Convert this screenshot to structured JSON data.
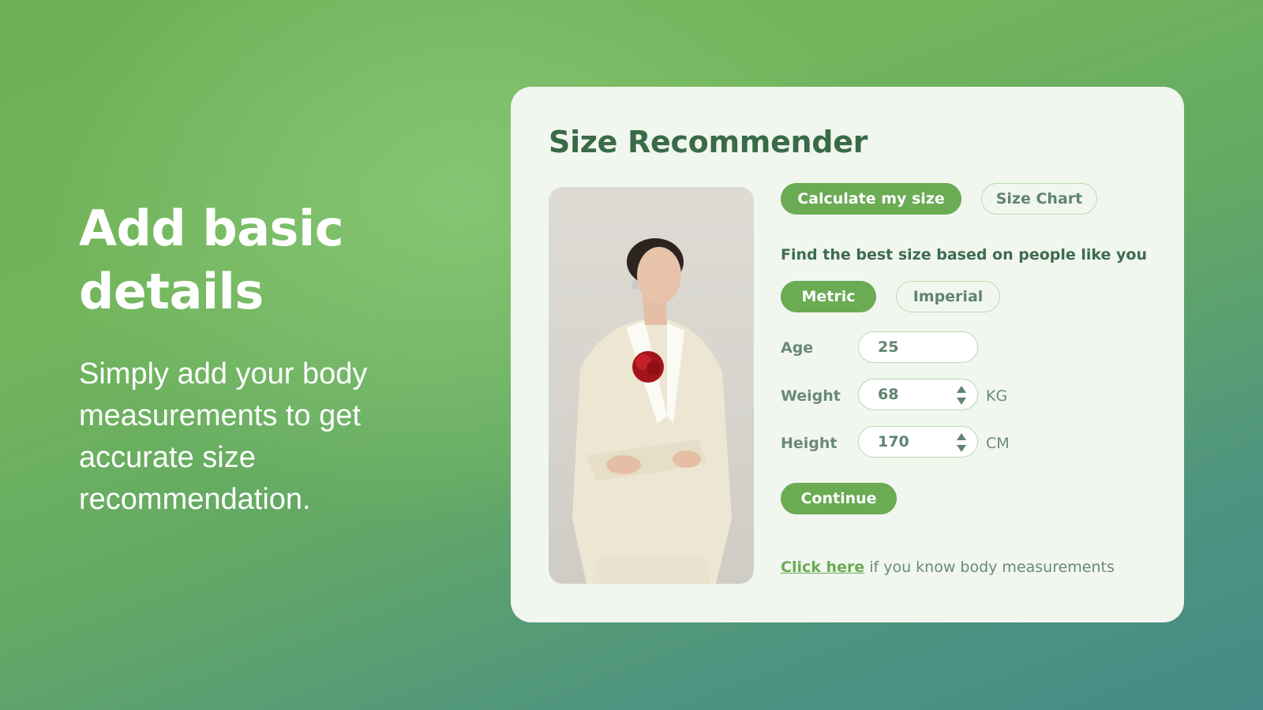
{
  "hero": {
    "title_line1": "Add basic",
    "title_line2": "details",
    "description": "Simply add your body measurements to get accurate size recommendation."
  },
  "card": {
    "title": "Size Recommender",
    "photo_alt": "Model wearing a cream suit with a red rose",
    "tabs": {
      "calculate": "Calculate my size",
      "size_chart": "Size Chart",
      "active": "calculate"
    },
    "subtitle": "Find the best size based on people like you",
    "units": {
      "metric": "Metric",
      "imperial": "Imperial",
      "active": "metric"
    },
    "fields": {
      "age": {
        "label": "Age",
        "value": "25"
      },
      "weight": {
        "label": "Weight",
        "value": "68",
        "unit": "KG"
      },
      "height": {
        "label": "Height",
        "value": "170",
        "unit": "CM"
      }
    },
    "continue_label": "Continue",
    "footer": {
      "link_text": "Click here",
      "rest_text": " if you know body measurements"
    }
  },
  "colors": {
    "accent": "#6aab53",
    "title": "#396b47",
    "card_bg": "#f1f6ef",
    "border": "#b9dcae"
  }
}
